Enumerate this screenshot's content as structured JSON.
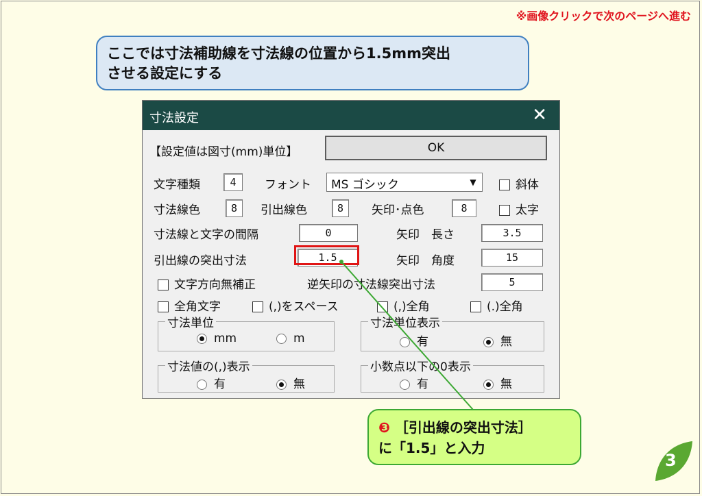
{
  "top_note": "※画像クリックで次のページへ進む",
  "callout": {
    "line1": "ここでは寸法補助線を寸法線の位置から1.5mm突出",
    "line2": "させる設定にする"
  },
  "dialog": {
    "title": "寸法設定",
    "close": "✕",
    "units_label": "【設定値は図寸(mm)単位】",
    "ok": "OK",
    "text_type_label": "文字種類",
    "text_type_value": "4",
    "font_label": "フォント",
    "font_value": "MS ゴシック",
    "italic_label": "斜体",
    "dim_line_color_label": "寸法線色",
    "dim_line_color_value": "8",
    "ext_line_color_label": "引出線色",
    "ext_line_color_value": "8",
    "arrow_color_label": "矢印･点色",
    "arrow_color_value": "8",
    "bold_label": "太字",
    "gap_label": "寸法線と文字の間隔",
    "gap_value": "0",
    "arrow_length_label": "矢印　長さ",
    "arrow_length_value": "3.5",
    "ext_overshoot_label": "引出線の突出寸法",
    "ext_overshoot_value": "1.5",
    "arrow_angle_label": "矢印　角度",
    "arrow_angle_value": "15",
    "no_dir_correct_label": "文字方向無補正",
    "reverse_arrow_label": "逆矢印の寸法線突出寸法",
    "reverse_arrow_value": "5",
    "fullwidth_label": "全角文字",
    "comma_space_label": "(,)をスペース",
    "comma_full_label": "(,)全角",
    "period_full_label": "(.)全角",
    "unit_group": {
      "label": "寸法単位",
      "opt1": "mm",
      "opt2": "m"
    },
    "unit_display_group": {
      "label": "寸法単位表示",
      "opt1": "有",
      "opt2": "無"
    },
    "comma_display_group": {
      "label": "寸法値の(,)表示",
      "opt1": "有",
      "opt2": "無"
    },
    "decimal_zero_group": {
      "label": "小数点以下の0表示",
      "opt1": "有",
      "opt2": "無"
    }
  },
  "step_callout": {
    "number": "❸",
    "line1": "［引出線の突出寸法］",
    "line2": "に「1.5」と入力"
  },
  "page_number": "3",
  "colors": {
    "background": "#fefde7",
    "titlebar": "#1b4a45",
    "highlight": "#e01515",
    "step_callout": "#d5ff85",
    "leaf": "#5aa832"
  }
}
